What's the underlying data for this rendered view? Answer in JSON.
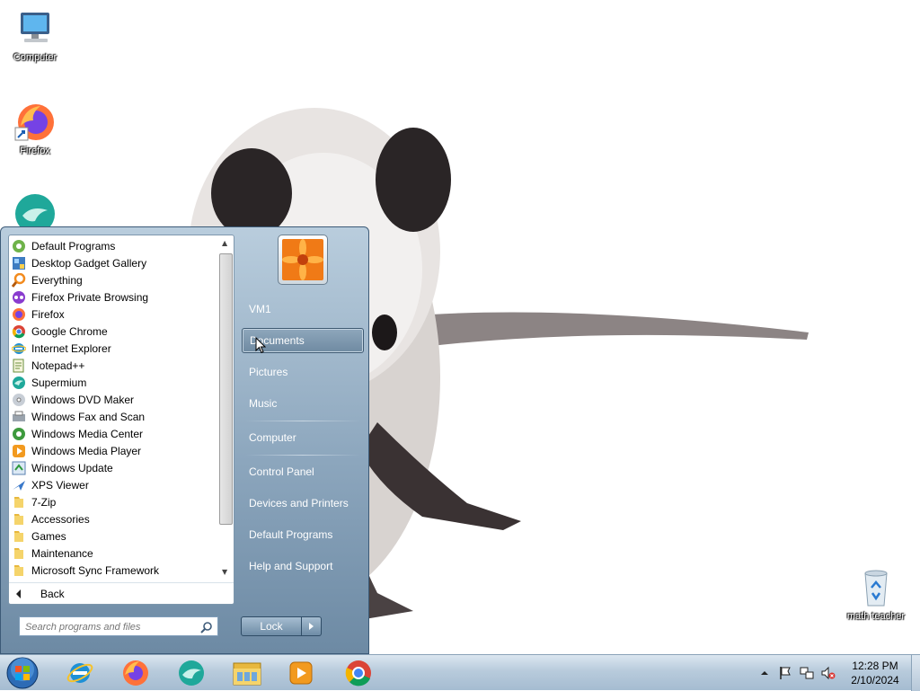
{
  "desktop": {
    "icons": [
      {
        "label": "Computer"
      },
      {
        "label": "Firefox"
      },
      {
        "label": ""
      },
      {
        "label": "math teacher"
      }
    ]
  },
  "start_menu": {
    "programs": [
      {
        "label": "Default Programs",
        "icon": "default-programs-icon"
      },
      {
        "label": "Desktop Gadget Gallery",
        "icon": "gadget-icon"
      },
      {
        "label": "Everything",
        "icon": "everything-search-icon"
      },
      {
        "label": "Firefox Private Browsing",
        "icon": "firefox-private-icon"
      },
      {
        "label": "Firefox",
        "icon": "firefox-icon"
      },
      {
        "label": "Google Chrome",
        "icon": "chrome-icon"
      },
      {
        "label": "Internet Explorer",
        "icon": "internet-explorer-icon"
      },
      {
        "label": "Notepad++",
        "icon": "notepad-plus-icon"
      },
      {
        "label": "Supermium",
        "icon": "supermium-icon"
      },
      {
        "label": "Windows DVD Maker",
        "icon": "dvd-maker-icon"
      },
      {
        "label": "Windows Fax and Scan",
        "icon": "fax-scan-icon"
      },
      {
        "label": "Windows Media Center",
        "icon": "media-center-icon"
      },
      {
        "label": "Windows Media Player",
        "icon": "media-player-icon"
      },
      {
        "label": "Windows Update",
        "icon": "windows-update-icon"
      },
      {
        "label": "XPS Viewer",
        "icon": "xps-viewer-icon"
      },
      {
        "label": "7-Zip",
        "icon": "folder-icon"
      },
      {
        "label": "Accessories",
        "icon": "folder-icon"
      },
      {
        "label": "Games",
        "icon": "folder-icon"
      },
      {
        "label": "Maintenance",
        "icon": "folder-icon"
      },
      {
        "label": "Microsoft Sync Framework",
        "icon": "folder-icon"
      }
    ],
    "back_label": "Back",
    "search_placeholder": "Search programs and files",
    "right_links": {
      "user": "VM1",
      "documents": "Documents",
      "pictures": "Pictures",
      "music": "Music",
      "computer": "Computer",
      "control_panel": "Control Panel",
      "devices": "Devices and Printers",
      "default_programs": "Default Programs",
      "help": "Help and Support"
    },
    "lock_label": "Lock"
  },
  "taskbar": {
    "apps": [
      {
        "name": "internet-explorer"
      },
      {
        "name": "firefox"
      },
      {
        "name": "supermium"
      },
      {
        "name": "windows-explorer"
      },
      {
        "name": "media-player"
      },
      {
        "name": "chrome"
      }
    ],
    "clock": {
      "time": "12:28 PM",
      "date": "2/10/2024"
    }
  },
  "colors": {
    "start_menu_accent": "#8ca6bd",
    "taskbar": "#b8cbdc"
  }
}
